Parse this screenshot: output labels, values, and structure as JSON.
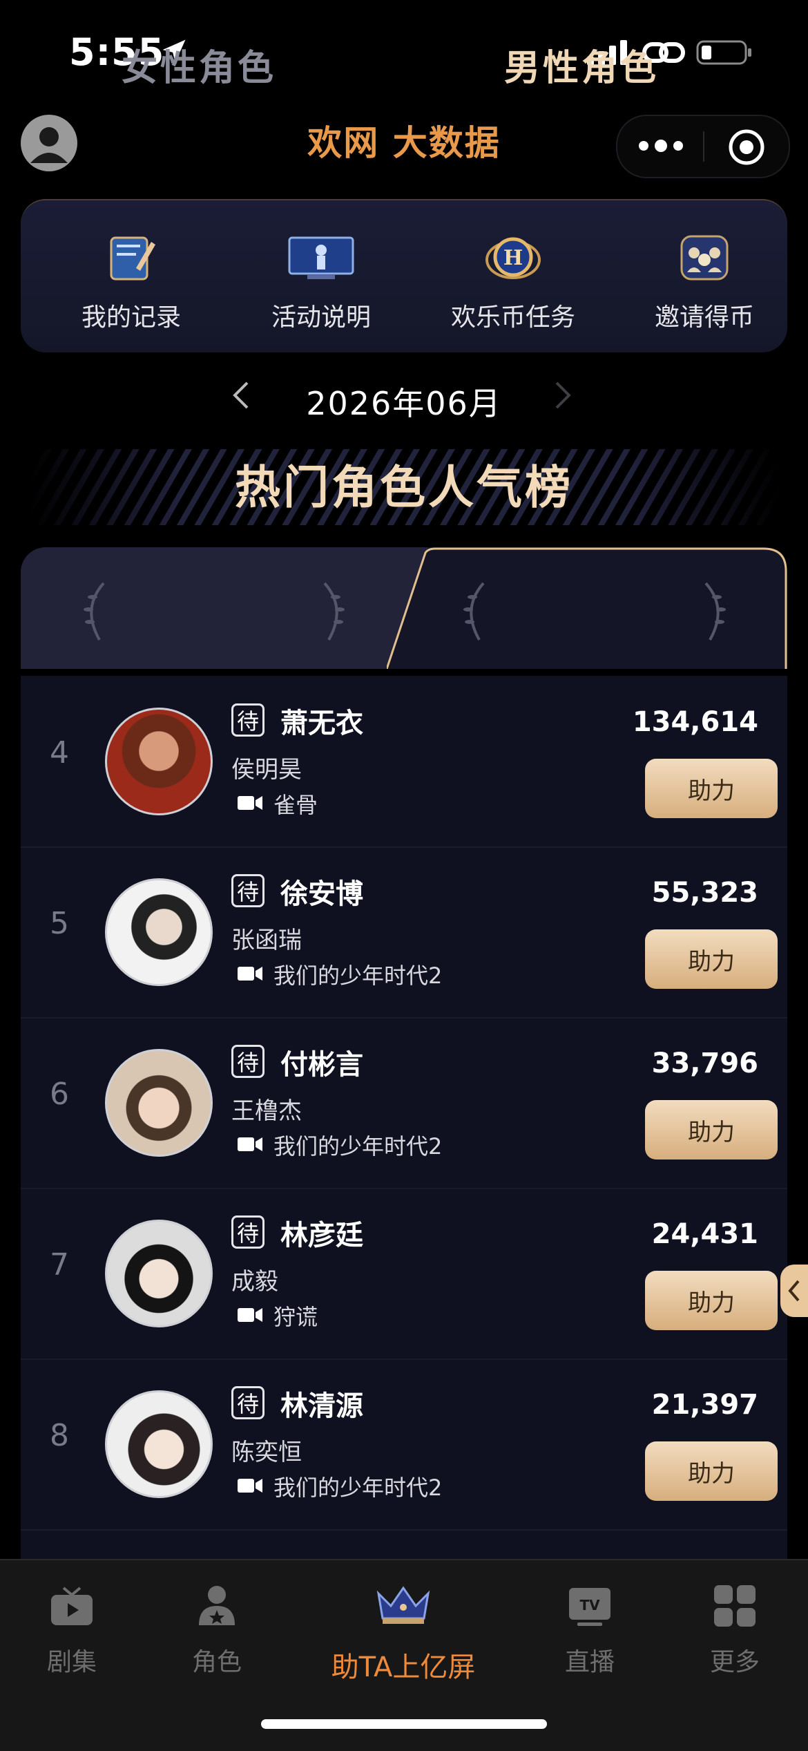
{
  "status_bar": {
    "time": "5:55"
  },
  "header": {
    "logo_text": "欢网 大数据"
  },
  "quick_menu": [
    {
      "label": "我的记录",
      "icon": "notebook-pen-icon"
    },
    {
      "label": "活动说明",
      "icon": "tv-screen-icon"
    },
    {
      "label": "欢乐币任务",
      "icon": "coin-h-icon"
    },
    {
      "label": "邀请得币",
      "icon": "group-icon"
    }
  ],
  "month": {
    "label": "2026年06月"
  },
  "ranking": {
    "title": "热门角色人气榜",
    "tabs": {
      "female": "女性角色",
      "male": "男性角色",
      "active": "male"
    },
    "tag_label": "待",
    "boost_label": "助力",
    "rows": [
      {
        "rank": "4",
        "name": "萧无衣",
        "actor": "侯明昊",
        "show": "雀骨",
        "votes": "134,614"
      },
      {
        "rank": "5",
        "name": "徐安博",
        "actor": "张函瑞",
        "show": "我们的少年时代2",
        "votes": "55,323"
      },
      {
        "rank": "6",
        "name": "付彬言",
        "actor": "王橹杰",
        "show": "我们的少年时代2",
        "votes": "33,796"
      },
      {
        "rank": "7",
        "name": "林彦廷",
        "actor": "成毅",
        "show": "狩谎",
        "votes": "24,431"
      },
      {
        "rank": "8",
        "name": "林清源",
        "actor": "陈奕恒",
        "show": "我们的少年时代2",
        "votes": "21,397"
      }
    ]
  },
  "bottom_nav": [
    {
      "label": "剧集",
      "icon": "play-tv-icon"
    },
    {
      "label": "角色",
      "icon": "person-star-icon"
    },
    {
      "label": "助TA上亿屏",
      "icon": "crown-icon",
      "highlight": true
    },
    {
      "label": "直播",
      "icon": "tv-live-icon"
    },
    {
      "label": "更多",
      "icon": "grid-icon"
    }
  ],
  "colors": {
    "accent": "#ef8a3a",
    "gold": "#f0d7b5",
    "panel": "#0f1020"
  }
}
